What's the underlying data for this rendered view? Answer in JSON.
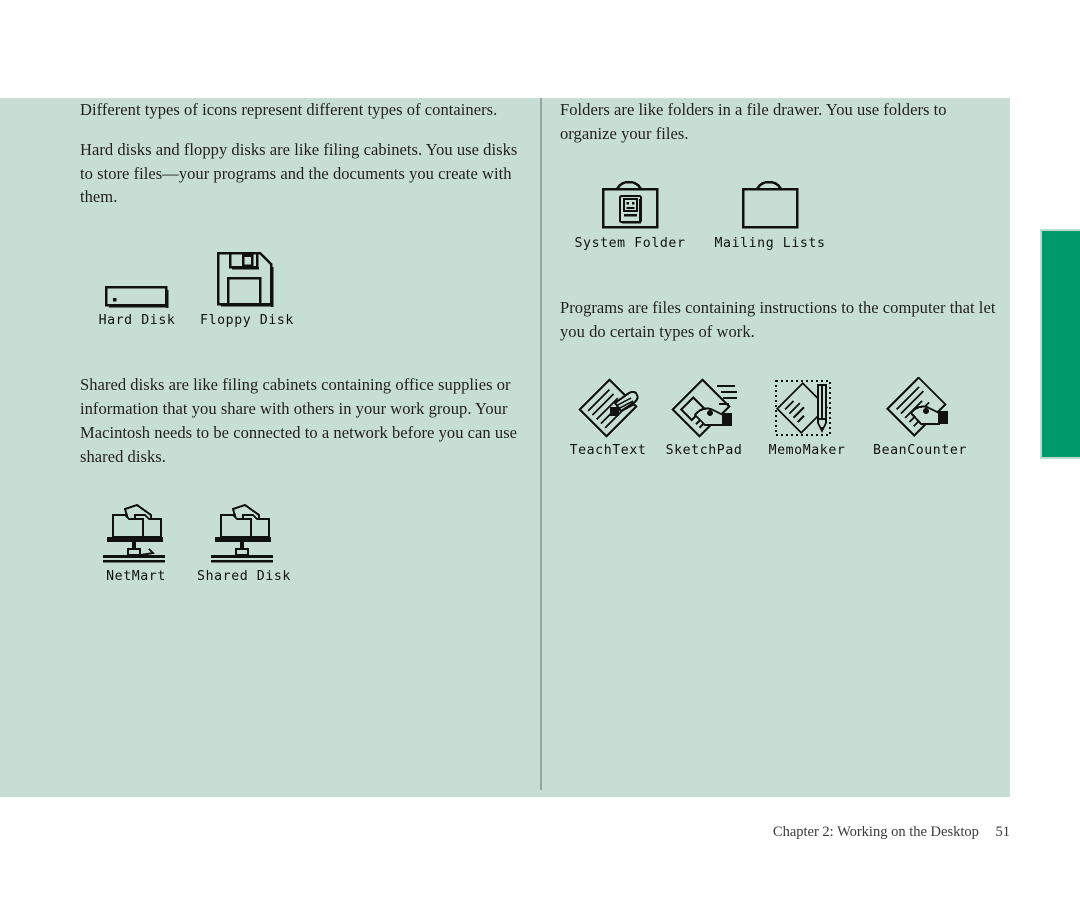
{
  "page": {
    "tint_color": "#c6ded3",
    "background_color": "#ffffff",
    "tab_color": "#00996b",
    "rule_color": "#9aa3a3",
    "footer_chapter": "Chapter 2: Working on the Desktop",
    "footer_page_number": "51"
  },
  "left_column": {
    "paragraphs": [
      "Different types of icons represent different types of containers.",
      "Hard disks and floppy disks are like filing cabinets. You use disks to store files—your programs and the documents you create with them.",
      "Shared disks are like filing cabinets containing office supplies or information that you share with others in your work group. Your Macintosh needs to be connected to a network before you can use shared disks."
    ],
    "disk_icons": [
      {
        "label": "Hard Disk",
        "icon": "hard-disk-icon"
      },
      {
        "label": "Floppy Disk",
        "icon": "floppy-disk-icon"
      }
    ],
    "shared_icons": [
      {
        "label": "NetMart",
        "icon": "shared-disk-icon"
      },
      {
        "label": "Shared Disk",
        "icon": "shared-disk-icon"
      }
    ]
  },
  "right_column": {
    "paragraphs": [
      "Folders are like folders in a file drawer. You use folders to organize your files.",
      "Programs are files containing instructions to the computer that let you do certain types of work."
    ],
    "folder_icons": [
      {
        "label": "System Folder",
        "icon": "system-folder-icon"
      },
      {
        "label": "Mailing Lists",
        "icon": "folder-icon"
      }
    ],
    "program_icons": [
      {
        "label": "TeachText",
        "icon": "teachtext-app-icon"
      },
      {
        "label": "SketchPad",
        "icon": "sketchpad-app-icon"
      },
      {
        "label": "MemoMaker",
        "icon": "memomaker-app-icon"
      },
      {
        "label": "BeanCounter",
        "icon": "beancounter-app-icon"
      }
    ]
  }
}
